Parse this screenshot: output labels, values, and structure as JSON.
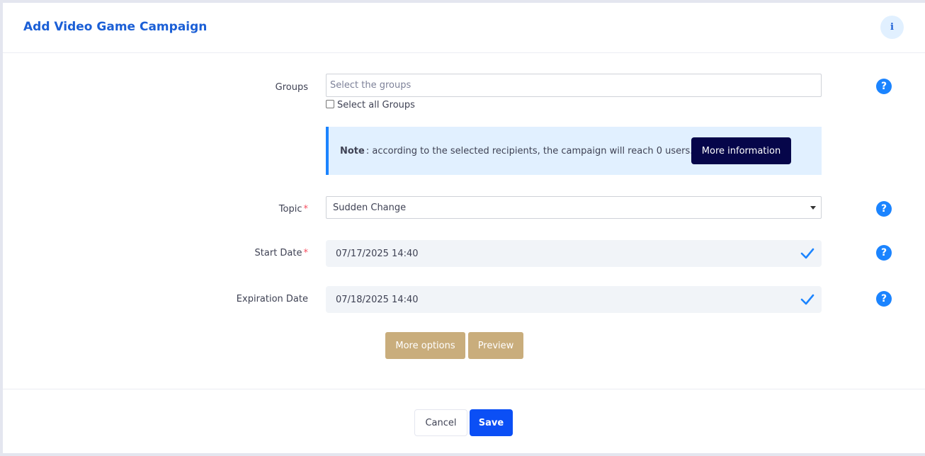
{
  "header": {
    "title": "Add Video Game Campaign",
    "info_icon": "i"
  },
  "form": {
    "groups": {
      "label": "Groups",
      "placeholder": "Select the groups",
      "select_all_label": "Select all Groups",
      "select_all_checked": false
    },
    "note": {
      "bold": "Note",
      "text": ": according to the selected recipients, the campaign will reach 0 users.",
      "button_label": "More information"
    },
    "topic": {
      "label": "Topic",
      "required_mark": "*",
      "value": "Sudden Change"
    },
    "start_date": {
      "label": "Start Date",
      "required_mark": "*",
      "value": "07/17/2025 14:40"
    },
    "expiration_date": {
      "label": "Expiration Date",
      "value": "07/18/2025 14:40"
    },
    "help_glyph": "?",
    "more_options_label": "More options",
    "preview_label": "Preview"
  },
  "footer": {
    "cancel_label": "Cancel",
    "save_label": "Save"
  },
  "colors": {
    "title_blue": "#1b5fd6",
    "help_blue": "#1b84ff",
    "note_bg": "#e1f0ff",
    "more_info_bg": "#06064a",
    "tan_button": "#c9ad7c",
    "save_blue": "#0b4ff5"
  }
}
